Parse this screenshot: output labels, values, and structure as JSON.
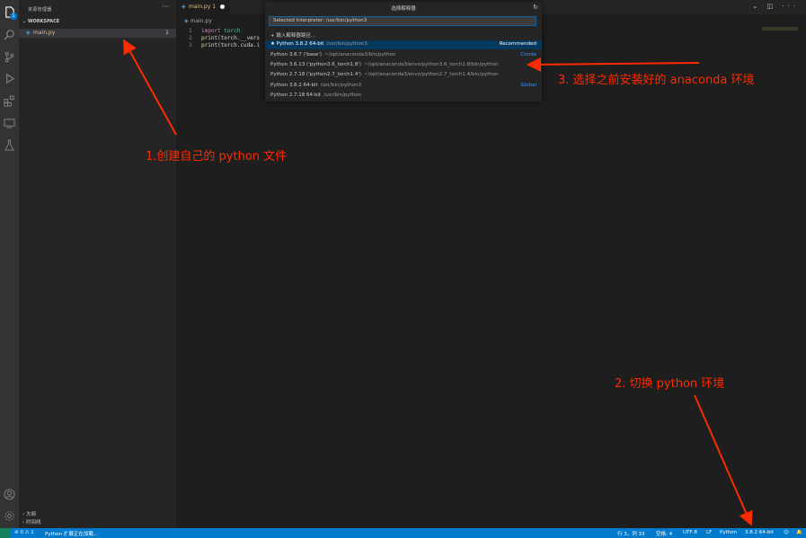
{
  "activity_bar": {
    "icons": [
      "explorer-icon",
      "search-icon",
      "source-control-icon",
      "run-debug-icon",
      "extensions-icon",
      "remote-explorer-icon",
      "testing-icon",
      "account-icon",
      "manage-gear-icon"
    ],
    "explorer_badge": "1"
  },
  "sidebar": {
    "title": "资源管理器",
    "more": "···",
    "workspace_header": "WORKSPACE",
    "files": [
      {
        "name": "main.py",
        "badge": "1"
      }
    ],
    "bottom_sections": [
      "大纲",
      "时间线"
    ]
  },
  "editor": {
    "tab": {
      "name": "main.py",
      "badge": "1"
    },
    "breadcrumb": "main.py",
    "actions": "⌄ ◫ ···",
    "code_lines": [
      {
        "num": "1",
        "tokens": [
          {
            "t": "import",
            "c": "kw"
          },
          {
            "t": " torch",
            "c": "id"
          }
        ]
      },
      {
        "num": "2",
        "tokens": [
          {
            "t": "print",
            "c": "fn"
          },
          {
            "t": "(torch.__vers",
            "c": "tx"
          }
        ]
      },
      {
        "num": "3",
        "tokens": [
          {
            "t": "print",
            "c": "fn"
          },
          {
            "t": "(torch.cuda.i",
            "c": "tx"
          }
        ]
      }
    ]
  },
  "quick_pick": {
    "title": "选择解释器",
    "input_value": "Selected Interpreter: /usr/bin/python3",
    "items": [
      {
        "label": "+ 输入解释器路径...",
        "desc": "",
        "right": "",
        "selected": false
      },
      {
        "label": "★ Python 3.8.2 64-bit",
        "desc": "/usr/bin/python3",
        "right": "Recommended",
        "selected": true
      },
      {
        "label": "Python 3.8.7 ('base')",
        "desc": "~/opt/anaconda3/bin/python",
        "right": "Conda",
        "selected": false
      },
      {
        "label": "Python 3.6.13 ('python3.6_torch1.8')",
        "desc": "~/opt/anaconda3/envs/python3.6_torch1.8/bin/python",
        "right": "",
        "selected": false
      },
      {
        "label": "Python 2.7.18 ('python2.7_torch1.4')",
        "desc": "~/opt/anaconda3/envs/python2.7_torch1.4/bin/python",
        "right": "",
        "selected": false
      },
      {
        "label": "Python 3.8.2 64-bit",
        "desc": "/usr/bin/python3",
        "right": "Global",
        "selected": false
      },
      {
        "label": "Python 2.7.18 64-bit",
        "desc": "/usr/bin/python",
        "right": "",
        "selected": false
      }
    ]
  },
  "status_bar": {
    "left": "⊘ 0 ⚠ 1",
    "message": "Python 扩展正在加载...",
    "position": "行 3，列 33",
    "spaces": "空格: 4",
    "encoding": "UTF-8",
    "eol": "LF",
    "language": "Python",
    "interpreter": "3.8.2 64-bit",
    "feedback": "☺",
    "notifications": "🔔"
  },
  "annotations": [
    {
      "id": "step1",
      "text": "1.创建自己的 python 文件"
    },
    {
      "id": "step2",
      "text": "2. 切换 python 环境"
    },
    {
      "id": "step3",
      "text": "3. 选择之前安装好的 anaconda 环境"
    }
  ],
  "colors": {
    "accent": "#007acc",
    "annotation": "#ff2a00",
    "selected": "#04395e",
    "file_modified": "#e2c08d"
  }
}
